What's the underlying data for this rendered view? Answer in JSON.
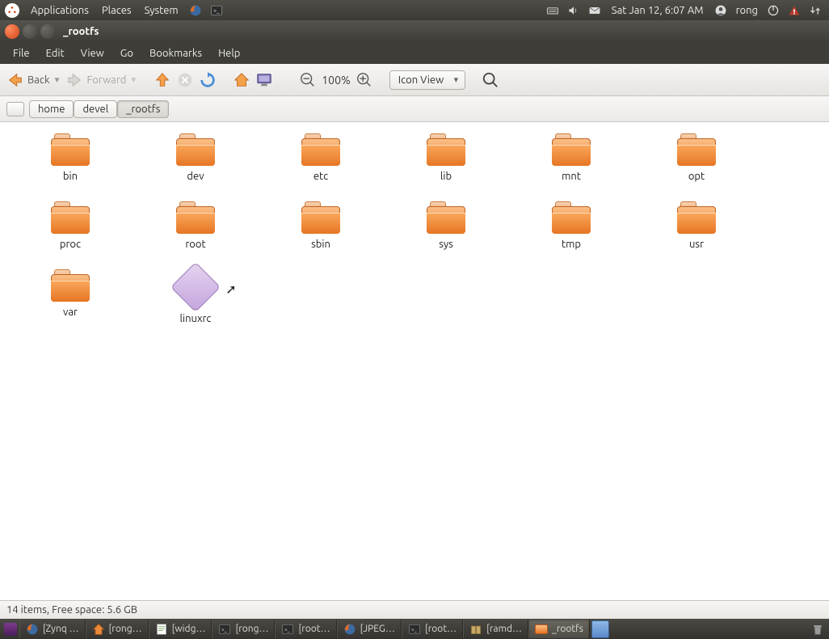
{
  "top_panel": {
    "menus": [
      "Applications",
      "Places",
      "System"
    ],
    "clock": "Sat Jan 12,  6:07 AM",
    "user": "rong"
  },
  "window": {
    "title": "_rootfs",
    "menubar": [
      "File",
      "Edit",
      "View",
      "Go",
      "Bookmarks",
      "Help"
    ],
    "toolbar": {
      "back": "Back",
      "forward": "Forward",
      "zoom": "100%",
      "view_mode": "Icon View"
    },
    "breadcrumbs": [
      "home",
      "devel",
      "_rootfs"
    ],
    "active_crumb": 2,
    "status": "14 items, Free space: 5.6 GB"
  },
  "folders": [
    "bin",
    "dev",
    "etc",
    "lib",
    "mnt",
    "opt",
    "proc",
    "root",
    "sbin",
    "sys",
    "tmp",
    "usr",
    "var"
  ],
  "files": [
    {
      "name": "linuxrc",
      "type": "script-link"
    }
  ],
  "taskbar": [
    {
      "label": "[Zynq …",
      "icon": "firefox"
    },
    {
      "label": "[rong…",
      "icon": "home"
    },
    {
      "label": "[widg…",
      "icon": "gedit"
    },
    {
      "label": "[rong…",
      "icon": "terminal"
    },
    {
      "label": "[root…",
      "icon": "terminal"
    },
    {
      "label": "[JPEG…",
      "icon": "firefox"
    },
    {
      "label": "[root…",
      "icon": "terminal"
    },
    {
      "label": "[ramd…",
      "icon": "archive"
    },
    {
      "label": "_rootfs",
      "icon": "folder",
      "active": true
    }
  ]
}
